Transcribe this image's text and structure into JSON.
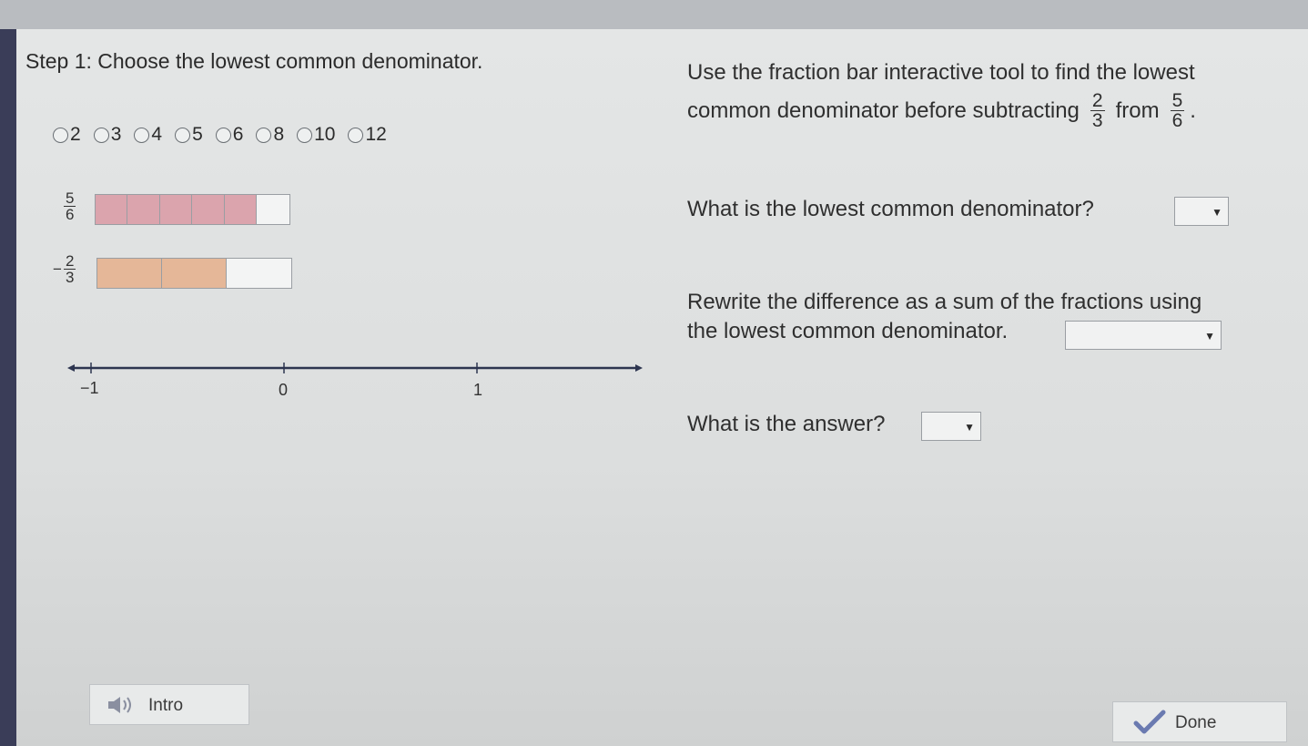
{
  "step": {
    "title": "Step 1: Choose the lowest common denominator."
  },
  "radio_options": [
    "2",
    "3",
    "4",
    "5",
    "6",
    "8",
    "10",
    "12"
  ],
  "fraction_bars": [
    {
      "numerator": "5",
      "denominator": "6",
      "sign": "",
      "segments": 6,
      "filled": 5,
      "color": "#dba4ad"
    },
    {
      "numerator": "2",
      "denominator": "3",
      "sign": "−",
      "segments": 3,
      "filled": 2,
      "color": "#e5b798"
    }
  ],
  "number_line": {
    "ticks": [
      "−1",
      "0",
      "1"
    ]
  },
  "instructions": {
    "line1": "Use the fraction bar interactive tool to find the lowest",
    "line2_prefix": "common denominator before subtracting",
    "frac_a_num": "2",
    "frac_a_den": "3",
    "from_word": "from",
    "frac_b_num": "5",
    "frac_b_den": "6",
    "end": "."
  },
  "questions": {
    "q1": "What is the lowest common denominator?",
    "q2_line1": "Rewrite the difference as a sum of the fractions using",
    "q2_line2": "the lowest common denominator.",
    "q3": "What is the answer?"
  },
  "buttons": {
    "intro": "Intro",
    "done": "Done"
  },
  "icons": {
    "speaker": "speaker-icon",
    "check": "checkmark-icon",
    "chevron": "chevron-down-icon"
  }
}
